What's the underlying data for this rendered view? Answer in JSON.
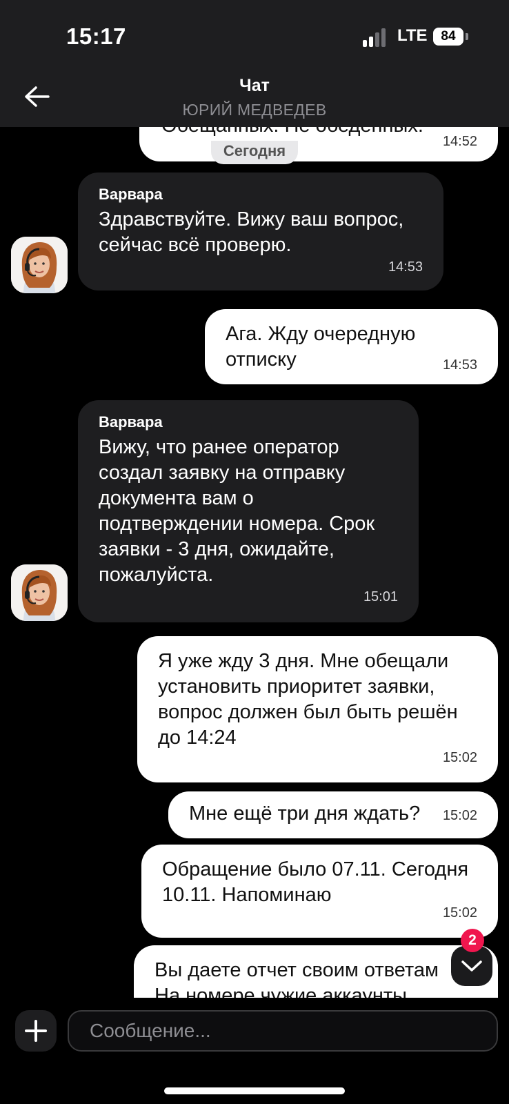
{
  "status_bar": {
    "time": "15:17",
    "network": "LTE",
    "battery": "84",
    "icons": [
      "signal-icon",
      "battery-icon"
    ]
  },
  "header": {
    "title": "Чат",
    "subtitle": "ЮРИЙ МЕДВЕДЕВ",
    "back_icon": "arrow-left-icon"
  },
  "chat": {
    "date_separator": "Сегодня",
    "messages": [
      {
        "direction": "out",
        "text": "Обещанных. Не обеденных.",
        "time": "14:52"
      },
      {
        "direction": "in",
        "sender": "Варвара",
        "text": "Здравствуйте. Вижу ваш вопрос,\nсейчас всё проверю.",
        "time": "14:53"
      },
      {
        "direction": "out",
        "text": "Ага. Жду очередную\nотписку",
        "time": "14:53"
      },
      {
        "direction": "in",
        "sender": "Варвара",
        "text": "Вижу, что ранее оператор\nсоздал заявку на отправку\nдокумента вам о\nподтверждении номера. Срок\nзаявки - 3 дня, ожидайте,\nпожалуйста.",
        "time": "15:01"
      },
      {
        "direction": "out",
        "text": "Я уже жду 3 дня. Мне обещали\nустановить приоритет заявки,\nвопрос должен был быть решён\nдо 14:24",
        "time": "15:02"
      },
      {
        "direction": "out",
        "text": "Мне ещё три дня ждать?",
        "time": "15:02"
      },
      {
        "direction": "out",
        "text": "Обращение было 07.11. Сегодня\n10.11. Напоминаю",
        "time": "15:02"
      },
      {
        "direction": "out",
        "text": "Вы даете отчет своим ответам\nНа номере чужие аккаунты",
        "time": ""
      }
    ]
  },
  "scroll_down": {
    "badge": "2",
    "icon": "chevron-down-icon"
  },
  "composer": {
    "placeholder": "Сообщение...",
    "add_icon": "plus-icon"
  },
  "colors": {
    "background": "#000000",
    "bar": "#1e1e20",
    "incoming": "#1e1e20",
    "outgoing": "#ffffff",
    "badge": "#f0164e"
  }
}
